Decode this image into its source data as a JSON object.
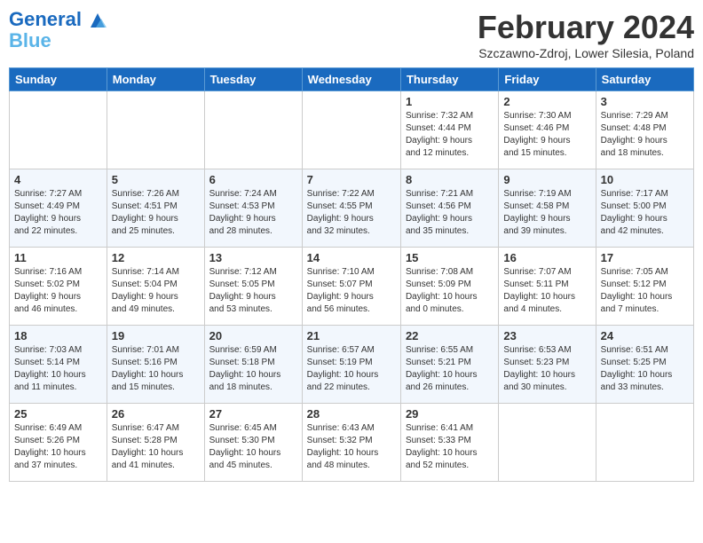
{
  "header": {
    "logo_line1": "General",
    "logo_line2": "Blue",
    "month": "February 2024",
    "location": "Szczawno-Zdroj, Lower Silesia, Poland"
  },
  "weekdays": [
    "Sunday",
    "Monday",
    "Tuesday",
    "Wednesday",
    "Thursday",
    "Friday",
    "Saturday"
  ],
  "weeks": [
    [
      {
        "day": "",
        "info": ""
      },
      {
        "day": "",
        "info": ""
      },
      {
        "day": "",
        "info": ""
      },
      {
        "day": "",
        "info": ""
      },
      {
        "day": "1",
        "info": "Sunrise: 7:32 AM\nSunset: 4:44 PM\nDaylight: 9 hours\nand 12 minutes."
      },
      {
        "day": "2",
        "info": "Sunrise: 7:30 AM\nSunset: 4:46 PM\nDaylight: 9 hours\nand 15 minutes."
      },
      {
        "day": "3",
        "info": "Sunrise: 7:29 AM\nSunset: 4:48 PM\nDaylight: 9 hours\nand 18 minutes."
      }
    ],
    [
      {
        "day": "4",
        "info": "Sunrise: 7:27 AM\nSunset: 4:49 PM\nDaylight: 9 hours\nand 22 minutes."
      },
      {
        "day": "5",
        "info": "Sunrise: 7:26 AM\nSunset: 4:51 PM\nDaylight: 9 hours\nand 25 minutes."
      },
      {
        "day": "6",
        "info": "Sunrise: 7:24 AM\nSunset: 4:53 PM\nDaylight: 9 hours\nand 28 minutes."
      },
      {
        "day": "7",
        "info": "Sunrise: 7:22 AM\nSunset: 4:55 PM\nDaylight: 9 hours\nand 32 minutes."
      },
      {
        "day": "8",
        "info": "Sunrise: 7:21 AM\nSunset: 4:56 PM\nDaylight: 9 hours\nand 35 minutes."
      },
      {
        "day": "9",
        "info": "Sunrise: 7:19 AM\nSunset: 4:58 PM\nDaylight: 9 hours\nand 39 minutes."
      },
      {
        "day": "10",
        "info": "Sunrise: 7:17 AM\nSunset: 5:00 PM\nDaylight: 9 hours\nand 42 minutes."
      }
    ],
    [
      {
        "day": "11",
        "info": "Sunrise: 7:16 AM\nSunset: 5:02 PM\nDaylight: 9 hours\nand 46 minutes."
      },
      {
        "day": "12",
        "info": "Sunrise: 7:14 AM\nSunset: 5:04 PM\nDaylight: 9 hours\nand 49 minutes."
      },
      {
        "day": "13",
        "info": "Sunrise: 7:12 AM\nSunset: 5:05 PM\nDaylight: 9 hours\nand 53 minutes."
      },
      {
        "day": "14",
        "info": "Sunrise: 7:10 AM\nSunset: 5:07 PM\nDaylight: 9 hours\nand 56 minutes."
      },
      {
        "day": "15",
        "info": "Sunrise: 7:08 AM\nSunset: 5:09 PM\nDaylight: 10 hours\nand 0 minutes."
      },
      {
        "day": "16",
        "info": "Sunrise: 7:07 AM\nSunset: 5:11 PM\nDaylight: 10 hours\nand 4 minutes."
      },
      {
        "day": "17",
        "info": "Sunrise: 7:05 AM\nSunset: 5:12 PM\nDaylight: 10 hours\nand 7 minutes."
      }
    ],
    [
      {
        "day": "18",
        "info": "Sunrise: 7:03 AM\nSunset: 5:14 PM\nDaylight: 10 hours\nand 11 minutes."
      },
      {
        "day": "19",
        "info": "Sunrise: 7:01 AM\nSunset: 5:16 PM\nDaylight: 10 hours\nand 15 minutes."
      },
      {
        "day": "20",
        "info": "Sunrise: 6:59 AM\nSunset: 5:18 PM\nDaylight: 10 hours\nand 18 minutes."
      },
      {
        "day": "21",
        "info": "Sunrise: 6:57 AM\nSunset: 5:19 PM\nDaylight: 10 hours\nand 22 minutes."
      },
      {
        "day": "22",
        "info": "Sunrise: 6:55 AM\nSunset: 5:21 PM\nDaylight: 10 hours\nand 26 minutes."
      },
      {
        "day": "23",
        "info": "Sunrise: 6:53 AM\nSunset: 5:23 PM\nDaylight: 10 hours\nand 30 minutes."
      },
      {
        "day": "24",
        "info": "Sunrise: 6:51 AM\nSunset: 5:25 PM\nDaylight: 10 hours\nand 33 minutes."
      }
    ],
    [
      {
        "day": "25",
        "info": "Sunrise: 6:49 AM\nSunset: 5:26 PM\nDaylight: 10 hours\nand 37 minutes."
      },
      {
        "day": "26",
        "info": "Sunrise: 6:47 AM\nSunset: 5:28 PM\nDaylight: 10 hours\nand 41 minutes."
      },
      {
        "day": "27",
        "info": "Sunrise: 6:45 AM\nSunset: 5:30 PM\nDaylight: 10 hours\nand 45 minutes."
      },
      {
        "day": "28",
        "info": "Sunrise: 6:43 AM\nSunset: 5:32 PM\nDaylight: 10 hours\nand 48 minutes."
      },
      {
        "day": "29",
        "info": "Sunrise: 6:41 AM\nSunset: 5:33 PM\nDaylight: 10 hours\nand 52 minutes."
      },
      {
        "day": "",
        "info": ""
      },
      {
        "day": "",
        "info": ""
      }
    ]
  ]
}
